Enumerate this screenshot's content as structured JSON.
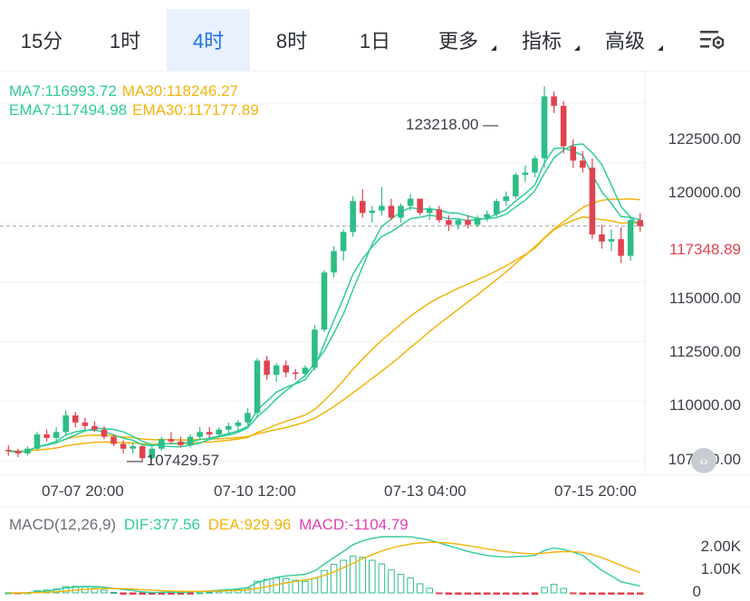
{
  "tabs": [
    {
      "label": "15分",
      "active": false,
      "dropdown": false
    },
    {
      "label": "1时",
      "active": false,
      "dropdown": false
    },
    {
      "label": "4时",
      "active": true,
      "dropdown": false
    },
    {
      "label": "8时",
      "active": false,
      "dropdown": false
    },
    {
      "label": "1日",
      "active": false,
      "dropdown": false
    },
    {
      "label": "更多",
      "active": false,
      "dropdown": true
    },
    {
      "label": "指标",
      "active": false,
      "dropdown": true
    },
    {
      "label": "高级",
      "active": false,
      "dropdown": true
    }
  ],
  "settings_icon": "chart-settings-icon",
  "indicators": {
    "ma7": "MA7:116993.72",
    "ma30": "MA30:118246.27",
    "ema7": "EMA7:117494.98",
    "ema30": "EMA30:117177.89"
  },
  "price_axis": [
    "122500.00",
    "120000.00",
    "115000.00",
    "112500.00",
    "110000.00",
    "107500.00"
  ],
  "current_price": "117348.89",
  "high_marker": "123218.00",
  "low_marker": "107429.57",
  "time_axis": [
    "07-07 20:00",
    "07-10 12:00",
    "07-13 04:00",
    "07-15 20:00"
  ],
  "macd": {
    "title": "MACD(12,26,9)",
    "dif": "DIF:377.56",
    "dea": "DEA:929.96",
    "macd": "MACD:-1104.79",
    "axis": [
      "2.00K",
      "1.00K",
      "0"
    ]
  },
  "colors": {
    "up": "#2ebd85",
    "down": "#e0434f",
    "ma7": "#2ecc9b",
    "ma30": "#f2b40c",
    "ema7": "#2ecc9b",
    "ema30": "#f2b40c",
    "macd_hist": "#e040b0",
    "accent": "#1e6fe6"
  },
  "chart_data": {
    "type": "candlestick",
    "interval": "4h",
    "ylim": [
      107000,
      123500
    ],
    "candles": [
      [
        107950,
        108150,
        107700,
        107900
      ],
      [
        107900,
        108000,
        107650,
        107800
      ],
      [
        107800,
        108100,
        107700,
        108000
      ],
      [
        108000,
        108700,
        107900,
        108600
      ],
      [
        108600,
        108800,
        108300,
        108450
      ],
      [
        108450,
        108900,
        108300,
        108700
      ],
      [
        108700,
        109600,
        108600,
        109400
      ],
      [
        109400,
        109550,
        108900,
        109100
      ],
      [
        109100,
        109300,
        108800,
        108950
      ],
      [
        108950,
        109150,
        108700,
        108800
      ],
      [
        108800,
        108950,
        108400,
        108500
      ],
      [
        108500,
        108600,
        108100,
        108200
      ],
      [
        108200,
        108350,
        107800,
        108000
      ],
      [
        108000,
        108250,
        107800,
        108100
      ],
      [
        108100,
        108150,
        107429,
        107600
      ],
      [
        107600,
        108100,
        107550,
        108000
      ],
      [
        108000,
        108500,
        107900,
        108400
      ],
      [
        108400,
        108700,
        108200,
        108300
      ],
      [
        108300,
        108500,
        108050,
        108150
      ],
      [
        108150,
        108600,
        108050,
        108500
      ],
      [
        108500,
        108900,
        108350,
        108700
      ],
      [
        108700,
        108900,
        108450,
        108600
      ],
      [
        108600,
        108900,
        108500,
        108800
      ],
      [
        108800,
        109100,
        108600,
        108950
      ],
      [
        108950,
        109200,
        108700,
        109100
      ],
      [
        109100,
        109700,
        109000,
        109500
      ],
      [
        109500,
        111800,
        109300,
        111700
      ],
      [
        111700,
        111900,
        110900,
        111100
      ],
      [
        111100,
        111600,
        110800,
        111500
      ],
      [
        111500,
        111700,
        111000,
        111200
      ],
      [
        111200,
        111350,
        110900,
        111150
      ],
      [
        111150,
        111500,
        111000,
        111400
      ],
      [
        111400,
        113200,
        111300,
        113000
      ],
      [
        113000,
        115500,
        112900,
        115400
      ],
      [
        115400,
        116500,
        115200,
        116300
      ],
      [
        116300,
        117200,
        115900,
        117100
      ],
      [
        117100,
        118600,
        116900,
        118400
      ],
      [
        118400,
        118900,
        117700,
        117900
      ],
      [
        117900,
        118200,
        117500,
        118000
      ],
      [
        118000,
        119000,
        117800,
        118200
      ],
      [
        118200,
        118500,
        117600,
        117700
      ],
      [
        117700,
        118300,
        117500,
        118200
      ],
      [
        118200,
        118700,
        118000,
        118500
      ],
      [
        118500,
        118500,
        117800,
        117900
      ],
      [
        117900,
        118200,
        117600,
        118050
      ],
      [
        118050,
        118200,
        117500,
        117600
      ],
      [
        117600,
        117800,
        117150,
        117400
      ],
      [
        117400,
        117700,
        117200,
        117600
      ],
      [
        117600,
        117800,
        117250,
        117400
      ],
      [
        117400,
        117800,
        117300,
        117700
      ],
      [
        117700,
        118000,
        117550,
        117850
      ],
      [
        117850,
        118500,
        117750,
        118400
      ],
      [
        118400,
        118800,
        118200,
        118600
      ],
      [
        118600,
        119600,
        118500,
        119500
      ],
      [
        119500,
        119900,
        119200,
        119600
      ],
      [
        119600,
        120300,
        119400,
        120200
      ],
      [
        120200,
        123218,
        119800,
        122800
      ],
      [
        122800,
        123000,
        122100,
        122400
      ],
      [
        122400,
        122600,
        120400,
        120700
      ],
      [
        120700,
        121000,
        119800,
        120100
      ],
      [
        120100,
        120500,
        119600,
        119800
      ],
      [
        119800,
        120200,
        116800,
        117000
      ],
      [
        117000,
        117400,
        116400,
        116700
      ],
      [
        116700,
        117200,
        116300,
        116800
      ],
      [
        116800,
        117300,
        115800,
        116100
      ],
      [
        116100,
        117700,
        115900,
        117600
      ],
      [
        117600,
        117900,
        117100,
        117349
      ]
    ],
    "macd": {
      "dif": 377.56,
      "dea": 929.96,
      "macd": -1104.79
    }
  }
}
